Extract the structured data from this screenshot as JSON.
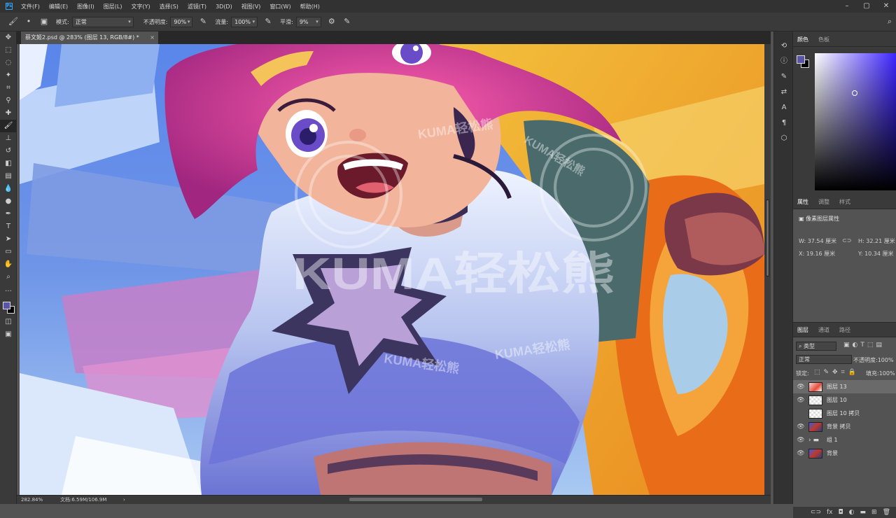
{
  "app": {
    "logo": "Ps"
  },
  "menu": [
    "文件(F)",
    "编辑(E)",
    "图像(I)",
    "图层(L)",
    "文字(Y)",
    "选择(S)",
    "滤镜(T)",
    "3D(D)",
    "视图(V)",
    "窗口(W)",
    "帮助(H)"
  ],
  "options": {
    "mode_label": "模式:",
    "mode_value": "正常",
    "opacity_label": "不透明度:",
    "opacity_value": "90%",
    "flow_label": "流量:",
    "flow_value": "100%",
    "smooth_label": "平滑:",
    "smooth_value": "9%"
  },
  "document": {
    "tab_title": "蔡文姬2.psd @ 283% (图层 13, RGB/8#) *",
    "zoom": "282.84%",
    "doc_info": "文档:6.59M/106.9M",
    "watermark": "KUMA轻松熊"
  },
  "color_panel": {
    "tabs": [
      "颜色",
      "色板"
    ],
    "fg_color": "#5a55a8",
    "bg_color": "#000000"
  },
  "properties_panel": {
    "tabs": [
      "属性",
      "调整",
      "样式"
    ],
    "header": "像素图层属性",
    "w_label": "W:",
    "w_value": "37.54 厘米",
    "h_label": "H:",
    "h_value": "32.21 厘米",
    "x_label": "X:",
    "x_value": "19.16 厘米",
    "y_label": "Y:",
    "y_value": "10.34 厘米"
  },
  "layers_panel": {
    "tabs": [
      "图层",
      "通道",
      "路径"
    ],
    "filter_label": "类型",
    "blend_mode": "正常",
    "opacity_label": "不透明度:",
    "opacity_value": "100%",
    "lock_label": "锁定:",
    "fill_label": "填充:",
    "fill_value": "100%",
    "layers": [
      {
        "name": "图层 13",
        "visible": true,
        "selected": true
      },
      {
        "name": "图层 10",
        "visible": true,
        "selected": false
      },
      {
        "name": "图层 10 拷贝",
        "visible": false,
        "selected": false
      },
      {
        "name": "背景 拷贝",
        "visible": true,
        "selected": false
      },
      {
        "name": "组 1",
        "visible": true,
        "selected": false,
        "group": true
      },
      {
        "name": "背景",
        "visible": true,
        "selected": false
      }
    ]
  }
}
